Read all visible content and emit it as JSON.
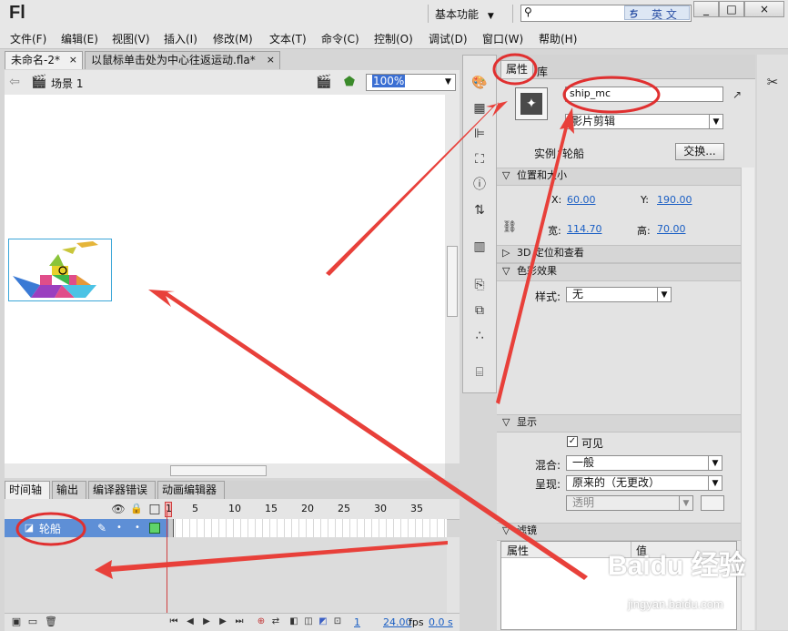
{
  "app": {
    "logo": "Fl",
    "workspace_label": "基本功能",
    "search_placeholder": "",
    "search_lang": "英 文",
    "window_buttons": [
      "_",
      "□",
      "×"
    ]
  },
  "menu": [
    "文件(F)",
    "编辑(E)",
    "视图(V)",
    "插入(I)",
    "修改(M)",
    "文本(T)",
    "命令(C)",
    "控制(O)",
    "调试(D)",
    "窗口(W)",
    "帮助(H)"
  ],
  "documents": [
    {
      "name": "未命名-2*",
      "close": "×"
    },
    {
      "name": "以鼠标单击处为中心往返运动.fla*",
      "close": "×"
    }
  ],
  "scene": {
    "label": "场景 1",
    "zoom": "100%"
  },
  "timeline": {
    "tabs": [
      "时间轴",
      "输出",
      "编译器错误",
      "动画编辑器"
    ],
    "ruler": [
      "1",
      "5",
      "10",
      "15",
      "20",
      "25",
      "30",
      "35"
    ],
    "layer_name": "轮船",
    "footer": {
      "frame": "1",
      "fps": "24.00",
      "fps_unit": "fps",
      "time": "0.0 s"
    }
  },
  "properties": {
    "tabs": [
      "属性",
      "库"
    ],
    "instance_name": "ship_mc",
    "symbol_type": "影片剪辑",
    "instance_label": "实例：",
    "instance_of": "轮船",
    "swap_button": "交换...",
    "sections": {
      "position": "位置和大小",
      "three_d": "3D 定位和查看",
      "color": "色彩效果",
      "display": "显示",
      "filters": "滤镜"
    },
    "x_label": "X:",
    "x_value": "60.00",
    "y_label": "Y:",
    "y_value": "190.00",
    "w_label": "宽:",
    "w_value": "114.70",
    "h_label": "高:",
    "h_value": "70.00",
    "style_label": "样式:",
    "style_value": "无",
    "visible_label": "可见",
    "blend_label": "混合:",
    "blend_value": "一般",
    "render_label": "呈现:",
    "render_value": "原来的（无更改）",
    "transparent_value": "透明",
    "filter_cols": [
      "属性",
      "值"
    ]
  },
  "watermark": {
    "brand": "Baidu 经验",
    "url": "jingyan.baidu.com"
  },
  "colors": {
    "annotation_red": "#e03030",
    "layer_blue": "#5e8fd6",
    "link_blue": "#1b5fc4"
  }
}
